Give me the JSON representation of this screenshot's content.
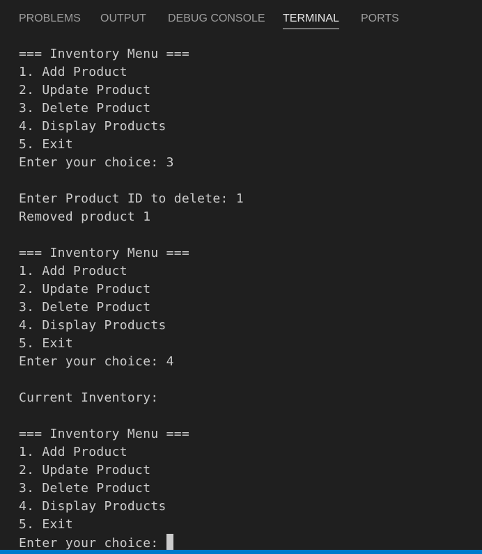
{
  "panel": {
    "tabs": [
      {
        "label": "PROBLEMS"
      },
      {
        "label": "OUTPUT"
      },
      {
        "label": "DEBUG CONSOLE"
      },
      {
        "label": "TERMINAL"
      },
      {
        "label": "PORTS"
      }
    ],
    "active_tab": "TERMINAL"
  },
  "terminal": {
    "lines": [
      "=== Inventory Menu ===",
      "1. Add Product",
      "2. Update Product",
      "3. Delete Product",
      "4. Display Products",
      "5. Exit",
      "Enter your choice: 3",
      "",
      "Enter Product ID to delete: 1",
      "Removed product 1",
      "",
      "=== Inventory Menu ===",
      "1. Add Product",
      "2. Update Product",
      "3. Delete Product",
      "4. Display Products",
      "5. Exit",
      "Enter your choice: 4",
      "",
      "Current Inventory:",
      "",
      "=== Inventory Menu ===",
      "1. Add Product",
      "2. Update Product",
      "3. Delete Product",
      "4. Display Products",
      "5. Exit",
      "Enter your choice:"
    ]
  },
  "colors": {
    "background": "#1f1f1f",
    "text": "#cccccc",
    "tab_inactive": "#9d9d9d",
    "tab_active": "#e7e7e7",
    "status_bar": "#007acc"
  }
}
